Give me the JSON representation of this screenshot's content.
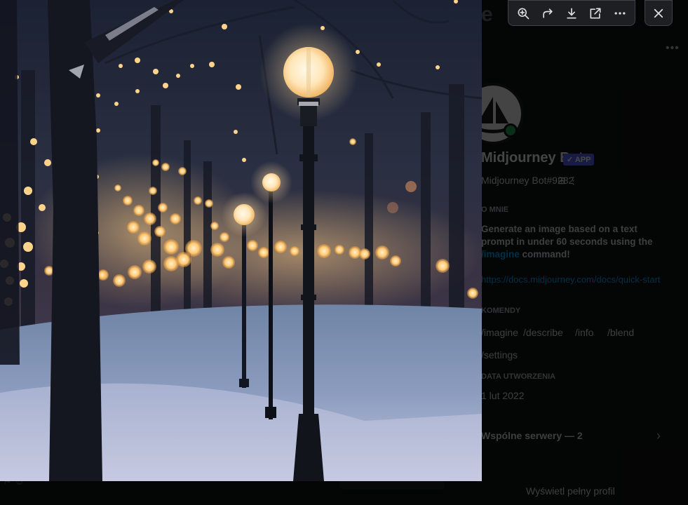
{
  "profile": {
    "bot_name": "Midjourney Bot",
    "bot_badge": "✓ APP",
    "bot_tag": "Midjourney Bot#9282",
    "bot_tag_extra": "⊞ ⋮",
    "about_heading": "O mnie",
    "about_text_before": "Generate an image based on a text prompt in under 60 seconds using the ",
    "about_command": "/imagine",
    "about_text_after": " command!",
    "about_link": "https://docs.midjourney.com/docs/quick-start",
    "commands_heading": "Komendy",
    "commands": [
      "/imagine",
      "/describe",
      "/info",
      "/blend",
      "/settings"
    ],
    "created_heading": "Data utworzenia",
    "created_date": "1 lut 2022",
    "mutual_label": "Wspólne serwery — 2",
    "mutual_arrow": "›",
    "more_menu": "•••",
    "full_profile": "Wyświetl pełny profil",
    "bg_fragment": "e"
  },
  "viewer": {
    "image_alt": "Snowy park path at night with glowing street lamps and string lights",
    "toolbar": {
      "zoom_icon": "zoom-in-icon",
      "share_icon": "forward-icon",
      "download_icon": "download-icon",
      "open_icon": "open-external-icon",
      "more_icon": "more-horizontal-icon"
    },
    "close_icon": "close-icon"
  },
  "colors": {
    "accent": "#5865f2",
    "link": "#00a8fc",
    "online": "#23a55a",
    "lamp_glow": "#ffd9a0"
  }
}
